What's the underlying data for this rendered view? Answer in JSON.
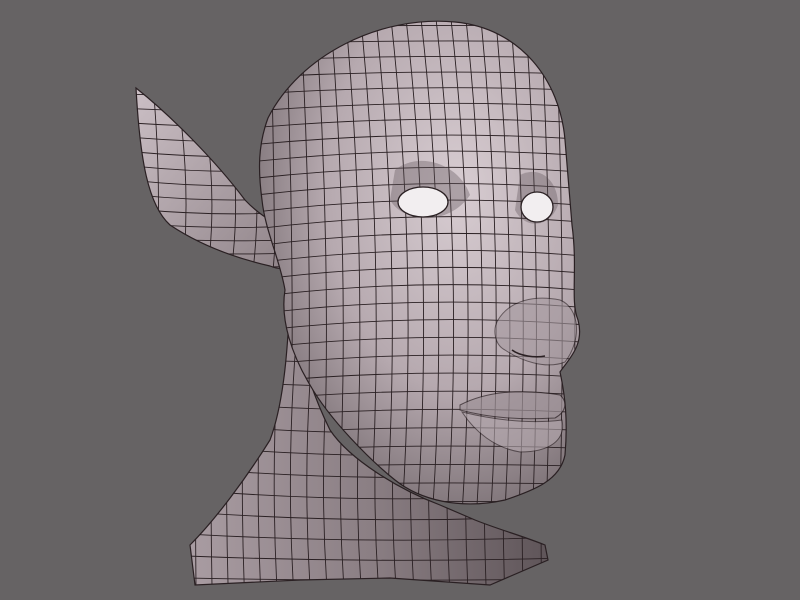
{
  "scene": {
    "background_color": "#666364",
    "skin_color": "#b9acb2",
    "skin_highlight": "#d8cdd2",
    "skin_shadow": "#6f6569",
    "wire_color": "#2a2023",
    "eye_color": "#f2eef0",
    "subject": "elf-head-wireframe-model"
  }
}
